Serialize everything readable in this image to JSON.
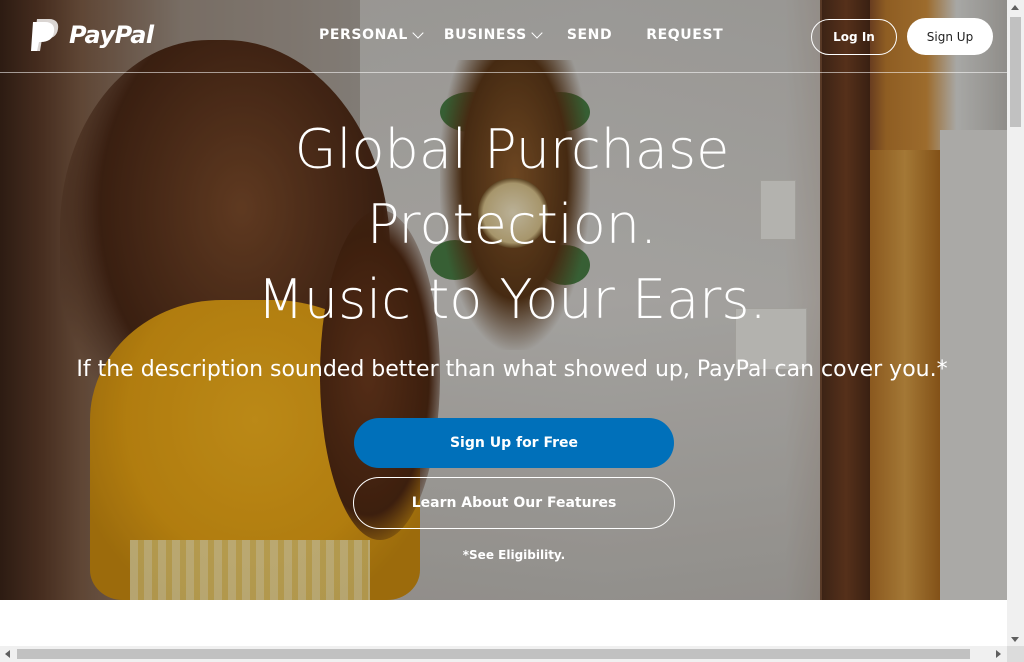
{
  "brand": {
    "name": "PayPal",
    "logo_icon": "paypal-p-icon"
  },
  "nav": {
    "items": [
      {
        "label": "PERSONAL",
        "has_dropdown": true
      },
      {
        "label": "BUSINESS",
        "has_dropdown": true
      },
      {
        "label": "SEND",
        "has_dropdown": false
      },
      {
        "label": "REQUEST",
        "has_dropdown": false
      }
    ],
    "login_label": "Log In",
    "signup_label": "Sign Up"
  },
  "hero": {
    "headline_lines": [
      "Global Purchase",
      "Protection.",
      "Music to Your Ears."
    ],
    "subtext": "If the description sounded better than what showed up, PayPal can cover you.*",
    "primary_cta": "Sign Up for Free",
    "secondary_cta": "Learn About Our Features",
    "footnote": "*See Eligibility."
  },
  "colors": {
    "primary_button": "#0070ba",
    "text_on_hero": "#ffffff"
  }
}
